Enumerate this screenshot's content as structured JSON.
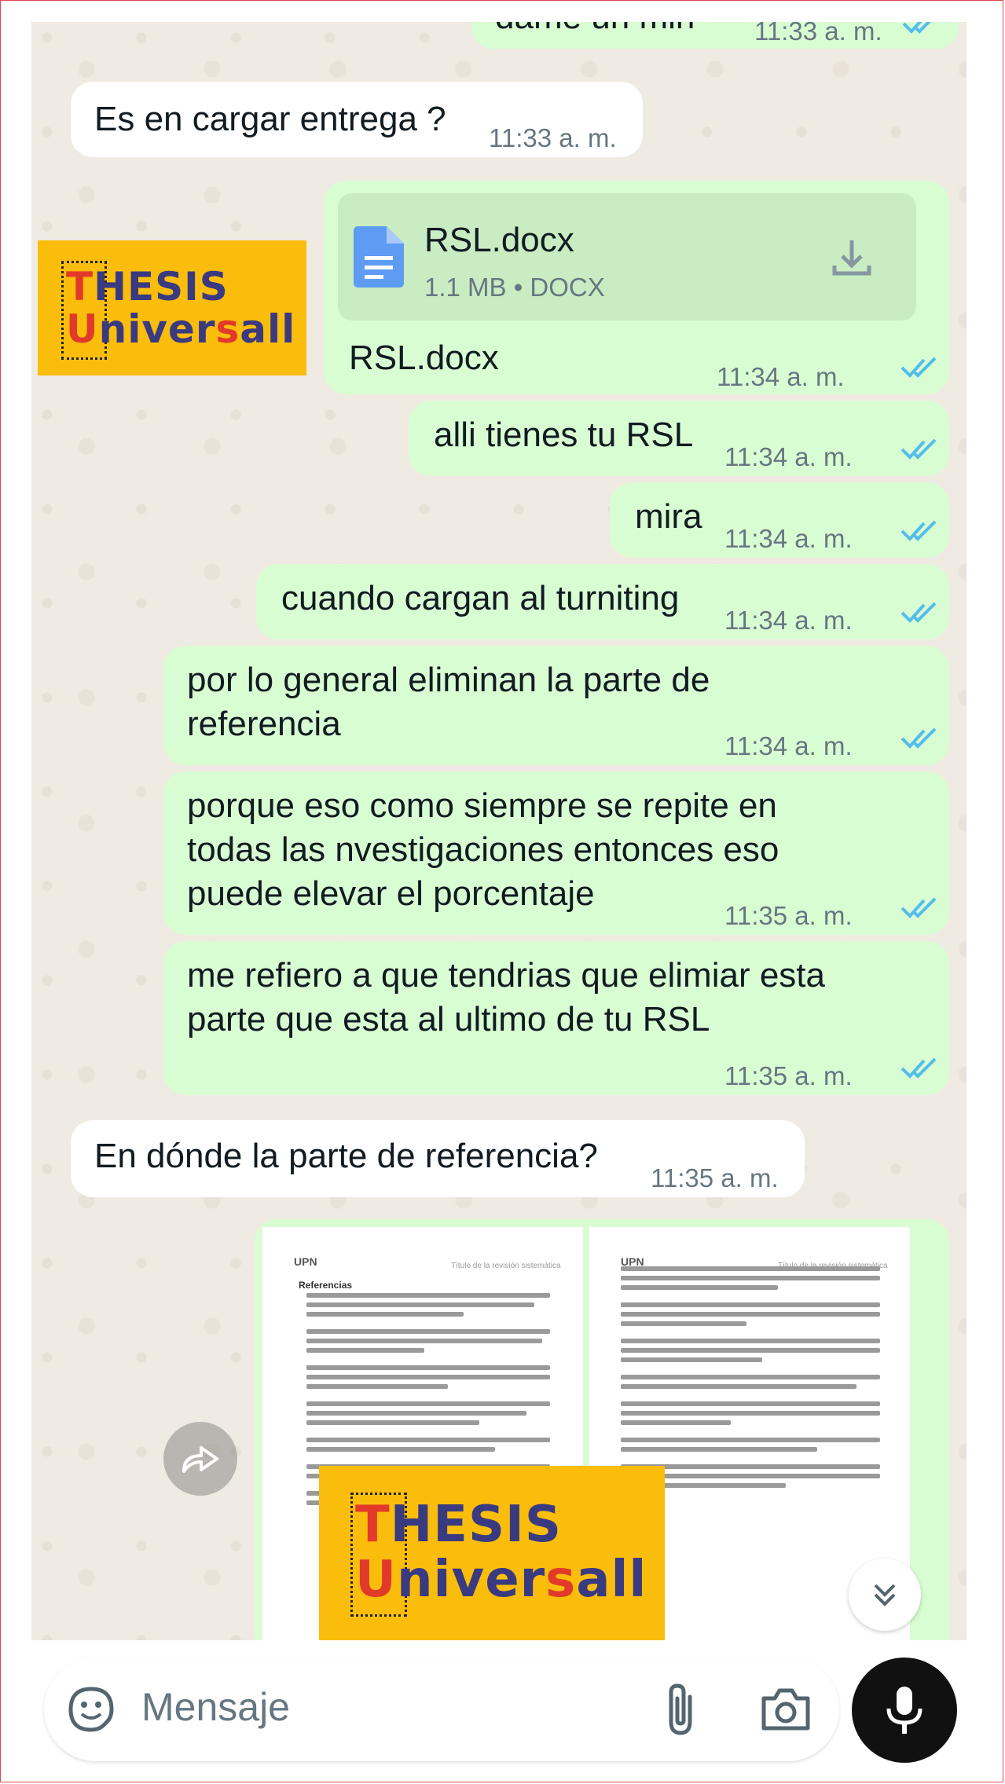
{
  "messages": [
    {
      "text": "dame un min",
      "time": "11:33 a. m."
    },
    {
      "text": "Es en cargar entrega ?",
      "time": "11:33 a. m."
    },
    {
      "doc_name": "RSL.docx",
      "doc_meta": "1.1 MB • DOCX",
      "caption": "RSL.docx",
      "time": "11:34 a. m."
    },
    {
      "text": "alli tienes tu RSL",
      "time": "11:34 a. m."
    },
    {
      "text": "mira",
      "time": "11:34 a. m."
    },
    {
      "text": "cuando cargan al turniting",
      "time": "11:34 a. m."
    },
    {
      "text": "por lo general eliminan la parte de\nreferencia",
      "time": "11:34 a. m."
    },
    {
      "text": "porque eso como siempre se repite en\ntodas las nvestigaciones entonces eso\npuede elevar el porcentaje",
      "time": "11:35 a. m."
    },
    {
      "text": "me refiero a que tendrias que elimiar esta\nparte que esta al ultimo de tu RSL",
      "time": "11:35 a. m."
    },
    {
      "text": "En dónde la parte de referencia?",
      "time": "11:35 a. m."
    }
  ],
  "watermark": {
    "line1_first": "T",
    "line1_rest": "HESIS",
    "line2_first": "U",
    "line2_mid": "niver",
    "line2_s": "s",
    "line2_end": "all"
  },
  "thumbnail": {
    "header_left": "UPN",
    "header_right": "Título de la revisión sistemática",
    "section_title": "Referencias"
  },
  "input": {
    "placeholder": "Mensaje"
  },
  "colors": {
    "outgoing": "#d9fdd3",
    "incoming": "#ffffff",
    "tick_blue": "#53bdeb",
    "mic_button": "#111111"
  },
  "icons": [
    "document-icon",
    "download-icon",
    "double-check-icon",
    "forward-icon",
    "scroll-down-icon",
    "sticker-icon",
    "attach-icon",
    "camera-icon",
    "mic-icon"
  ]
}
